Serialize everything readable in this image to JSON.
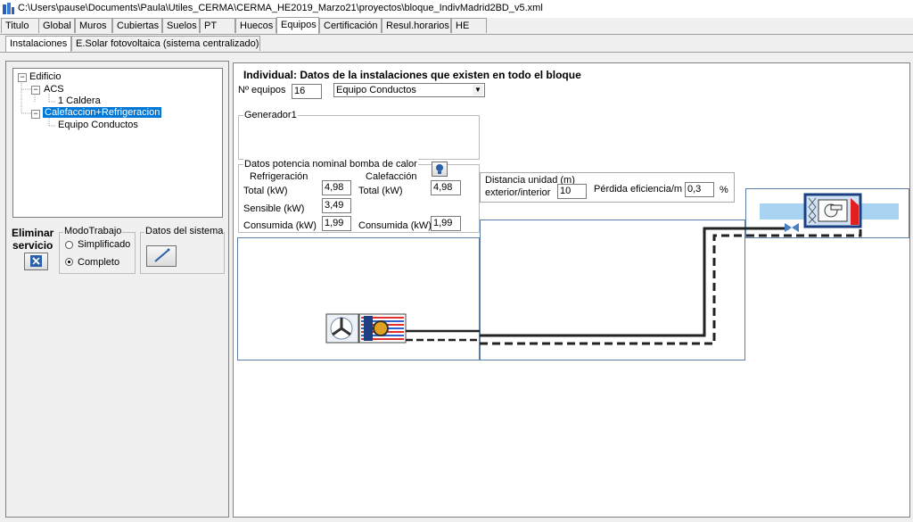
{
  "window": {
    "title": "C:\\Users\\pause\\Documents\\Paula\\Utiles_CERMA\\CERMA_HE2019_Marzo21\\proyectos\\bloque_IndivMadrid2BD_v5.xml"
  },
  "main_tabs": [
    "Titulo",
    "Global",
    "Muros",
    "Cubiertas",
    "Suelos",
    "PT",
    "Huecos",
    "Equipos",
    "Certificación",
    "Resul.horarios",
    "HE"
  ],
  "sub_tabs": [
    "Instalaciones",
    "E.Solar fotovoltaica (sistema centralizado)"
  ],
  "tree": {
    "root": "Edificio",
    "acs": "ACS",
    "caldera": "1 Caldera",
    "calef": "Calefaccion+Refrigeracion",
    "equipo": "Equipo Conductos"
  },
  "left": {
    "eliminar_line1": "Eliminar",
    "eliminar_line2": "servicio",
    "modo_title": "ModoTrabajo",
    "modo_simplificado": "Simplificado",
    "modo_completo": "Completo",
    "datos_sistema": "Datos del sistema"
  },
  "right": {
    "heading": "Individual: Datos de la instalaciones que existen en todo el bloque",
    "n_equipos_label": "Nº equipos",
    "n_equipos_value": "16",
    "equipo_select": "Equipo Conductos",
    "generador_title": "Generador1",
    "potencia_title": "Datos potencia nominal bomba de calor",
    "refrigeracion": "Refrigeración",
    "calefaccion": "Calefacción",
    "total_label": "Total (kW)",
    "total_refrig": "4,98",
    "total_calef": "4,98",
    "sensible_label": "Sensible (kW)",
    "sensible_value": "3,49",
    "consumida_label": "Consumida (kW)",
    "consumida_refrig": "1,99",
    "consumida_calef_label": "Consumida (kW)",
    "consumida_calef": "1,99",
    "distancia_line1": "Distancia unidad (m)",
    "distancia_line2": "exterior/interior",
    "distancia_value": "10",
    "perdida_label": "Pérdida eficiencia/m",
    "perdida_value": "0,3",
    "perdida_unit": "%"
  },
  "colors": {
    "selection": "#0078d7",
    "pipe_blue": "#a8d4f2",
    "unit_red": "#e02020",
    "frame_blue": "#5b7fa8"
  }
}
